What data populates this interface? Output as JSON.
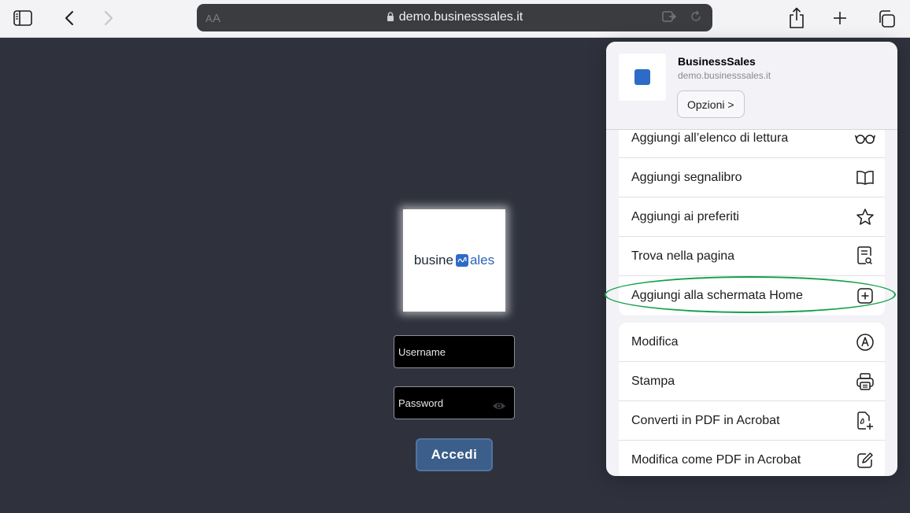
{
  "browser": {
    "url": "demo.businesssales.it",
    "aa_small": "A",
    "aa_big": "A"
  },
  "login": {
    "logo_part1": "busine",
    "logo_part2": "ales",
    "username_placeholder": "Username",
    "password_placeholder": "Password",
    "submit_label": "Accedi"
  },
  "share_sheet": {
    "app_name": "BusinessSales",
    "app_domain": "demo.businesssales.it",
    "options_label": "Opzioni >",
    "group1": [
      {
        "label": "Aggiungi all’elenco di lettura",
        "icon": "glasses-icon"
      },
      {
        "label": "Aggiungi segnalibro",
        "icon": "book-icon"
      },
      {
        "label": "Aggiungi ai preferiti",
        "icon": "star-icon"
      },
      {
        "label": "Trova nella pagina",
        "icon": "find-page-icon"
      },
      {
        "label": "Aggiungi alla schermata Home",
        "icon": "add-square-icon"
      }
    ],
    "group2": [
      {
        "label": "Modifica",
        "icon": "markup-icon"
      },
      {
        "label": "Stampa",
        "icon": "printer-icon"
      },
      {
        "label": "Converti in PDF in Acrobat",
        "icon": "pdf-convert-icon"
      },
      {
        "label": "Modifica come PDF in Acrobat",
        "icon": "pdf-edit-icon"
      }
    ]
  },
  "colors": {
    "page_bg": "#2f323d",
    "accent_button": "#3b5e8a",
    "highlight_ring": "#13a049"
  }
}
